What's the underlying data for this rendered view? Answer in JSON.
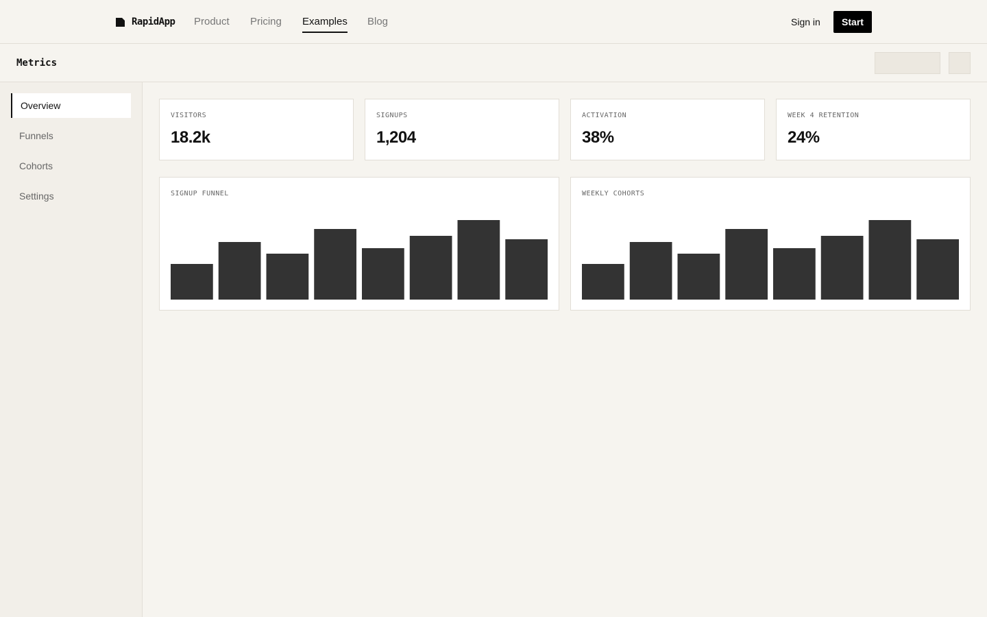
{
  "nav": {
    "brand": "RapidApp",
    "links": [
      {
        "label": "Product",
        "active": false
      },
      {
        "label": "Pricing",
        "active": false
      },
      {
        "label": "Examples",
        "active": true
      },
      {
        "label": "Blog",
        "active": false
      }
    ],
    "sign_in": "Sign in",
    "start": "Start"
  },
  "subheader": {
    "title": "Metrics"
  },
  "sidebar": {
    "items": [
      {
        "label": "Overview",
        "active": true
      },
      {
        "label": "Funnels",
        "active": false
      },
      {
        "label": "Cohorts",
        "active": false
      },
      {
        "label": "Settings",
        "active": false
      }
    ]
  },
  "kpis": [
    {
      "label": "VISITORS",
      "value": "18.2k"
    },
    {
      "label": "SIGNUPS",
      "value": "1,204"
    },
    {
      "label": "ACTIVATION",
      "value": "38%"
    },
    {
      "label": "WEEK 4 RETENTION",
      "value": "24%"
    }
  ],
  "colors": {
    "background": "#f6f4ef",
    "bar": "#333333",
    "accent": "#000000"
  },
  "chart_data": [
    {
      "type": "bar",
      "title": "SIGNUP FUNNEL",
      "values": [
        52,
        84,
        67,
        103,
        75,
        93,
        116,
        88
      ],
      "ylim": [
        0,
        116
      ]
    },
    {
      "type": "bar",
      "title": "WEEKLY COHORTS",
      "values": [
        52,
        84,
        67,
        103,
        75,
        93,
        116,
        88
      ],
      "ylim": [
        0,
        116
      ]
    }
  ]
}
